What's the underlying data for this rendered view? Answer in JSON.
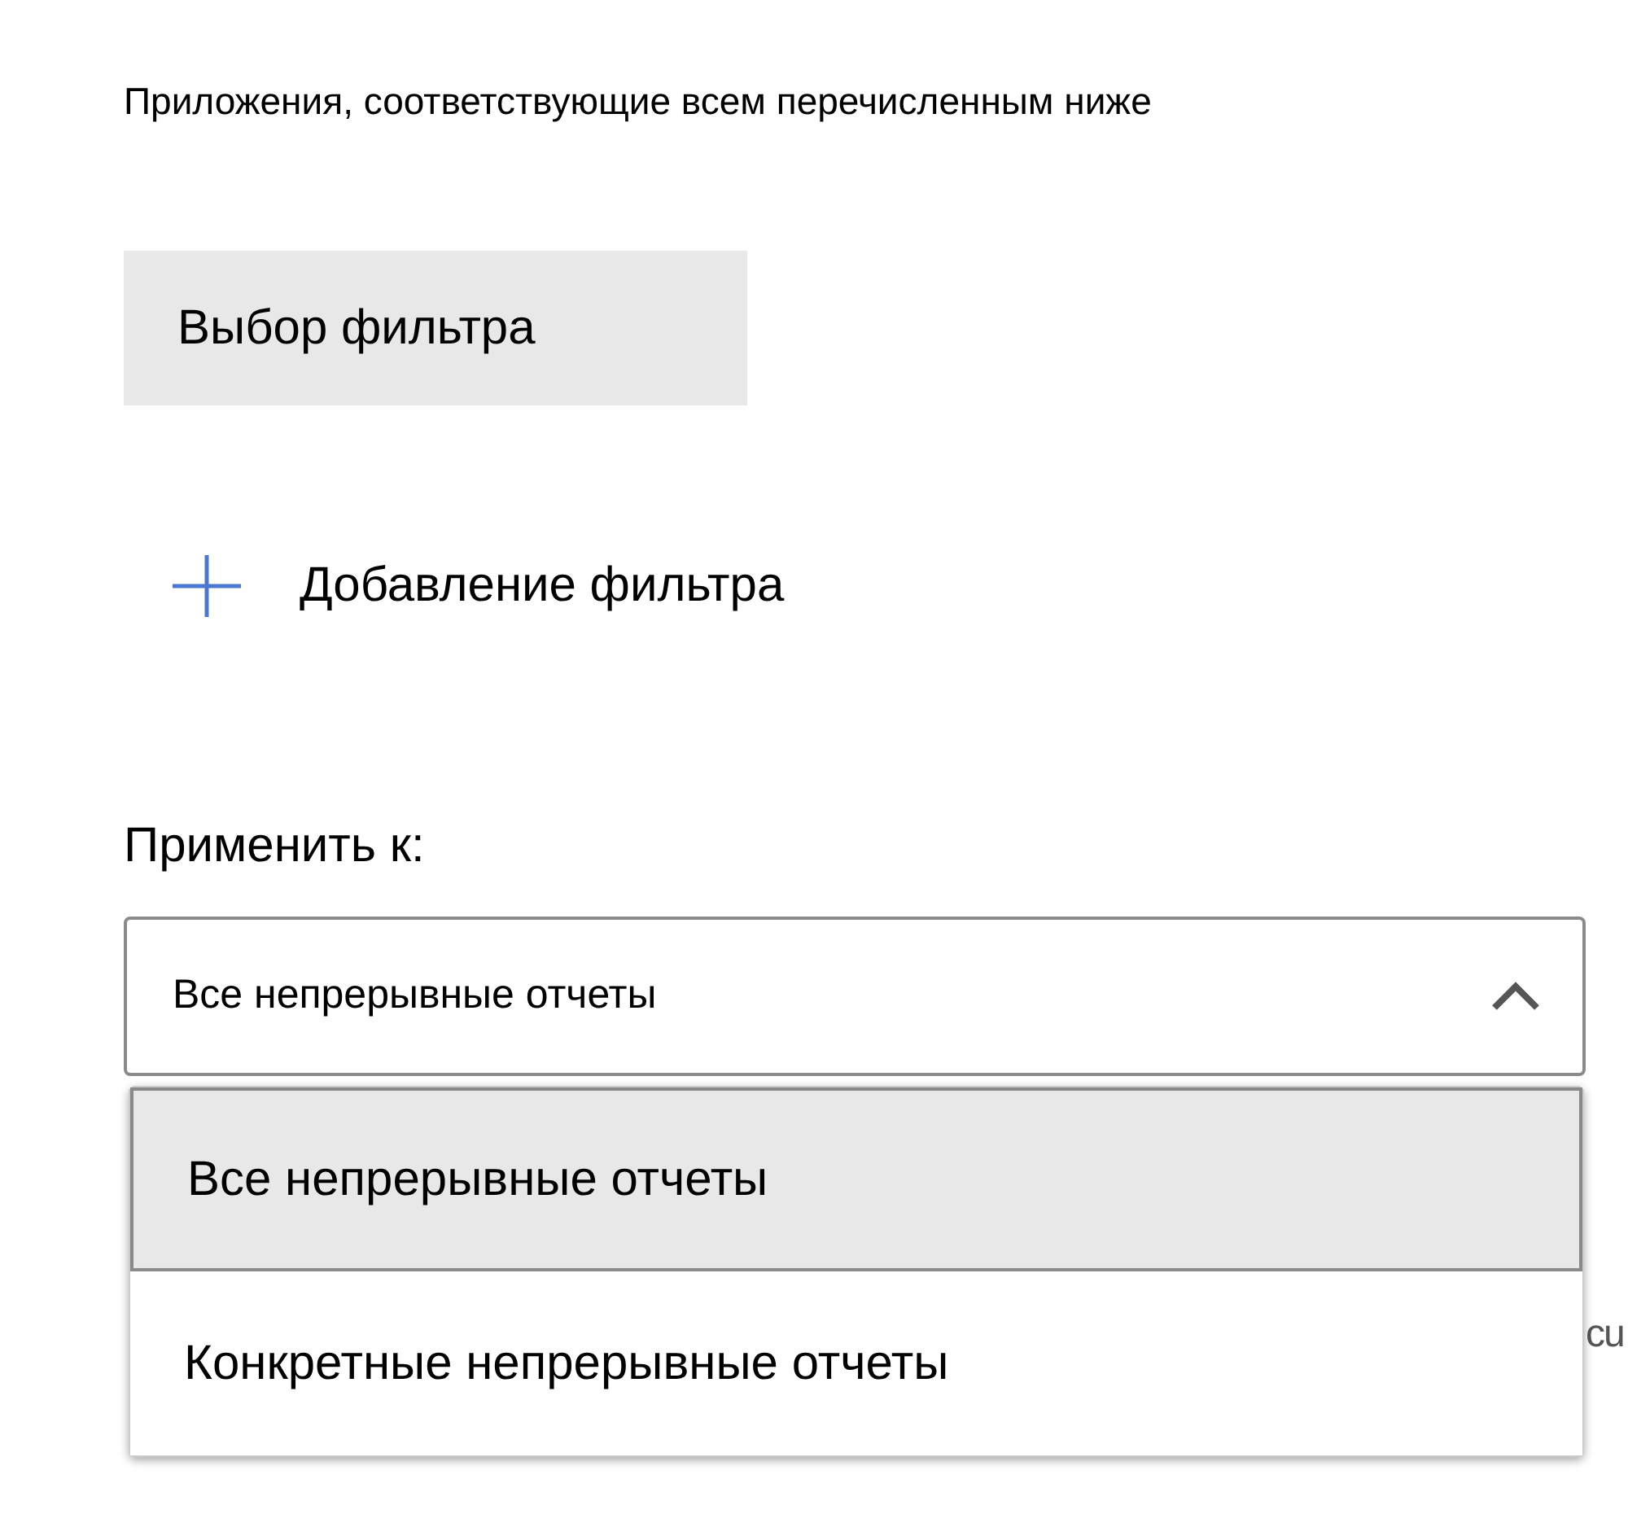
{
  "description": "Приложения, соответствующие всем перечисленным ниже",
  "filter_button": {
    "label": "Выбор фильтра"
  },
  "add_filter": {
    "label": "Добавление фильтра"
  },
  "apply_to": {
    "label": "Применить к:",
    "value": "Все непрерывные отчеты",
    "expanded": true,
    "options": [
      {
        "label": "Все непрерывные отчеты",
        "selected": true
      },
      {
        "label": "Конкретные непрерывные отчеты",
        "selected": false
      }
    ]
  },
  "hidden_text": "cu"
}
